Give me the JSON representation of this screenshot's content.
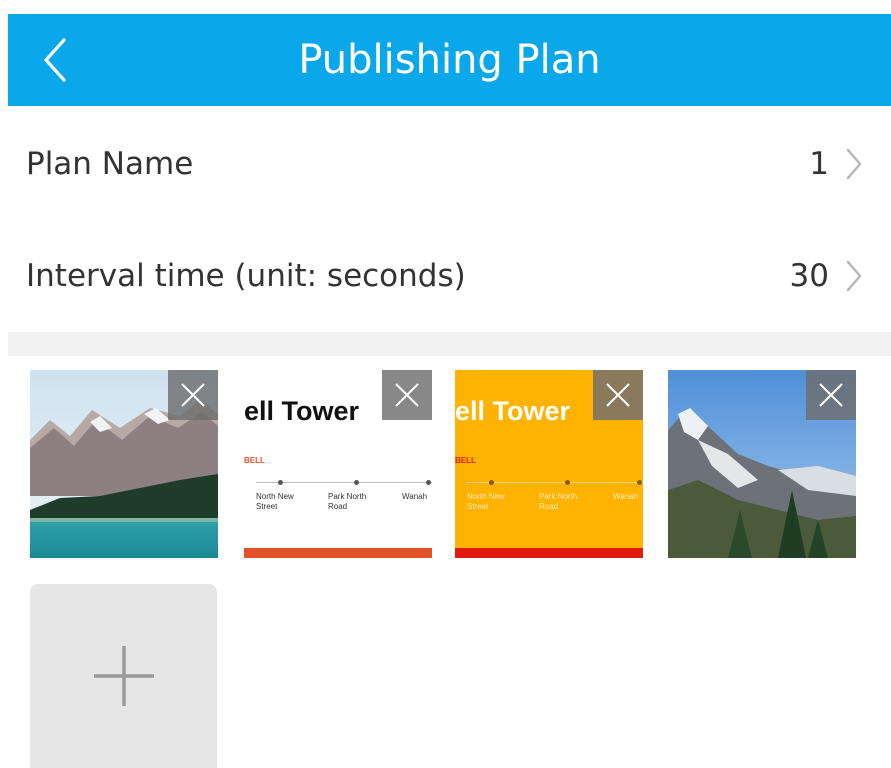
{
  "header": {
    "title": "Publishing Plan",
    "back_icon": "chevron-left-icon",
    "background_color": "#0aa7ea"
  },
  "settings": {
    "plan_name": {
      "label": "Plan Name",
      "value": "1",
      "chevron_icon": "chevron-right-icon"
    },
    "interval": {
      "label": "Interval time (unit: seconds)",
      "value": "30",
      "chevron_icon": "chevron-right-icon"
    }
  },
  "media": {
    "items": [
      {
        "kind": "image",
        "description_icon": "mountain-lake-photo"
      },
      {
        "kind": "slide",
        "title": "ell Tower",
        "tag": "BELL",
        "stops": [
          "North New Street",
          "Park North Road",
          "Wanah"
        ],
        "background": "#ffffff",
        "title_color": "#111111",
        "bar_color": "#e0522a"
      },
      {
        "kind": "slide",
        "title": "ell Tower",
        "tag": "BELL",
        "stops": [
          "North New Street",
          "Park North Road",
          "Wanah"
        ],
        "background": "#ffb300",
        "title_color": "#ffffff",
        "bar_color": "#e21c0c"
      },
      {
        "kind": "image",
        "description_icon": "mountain-trees-photo"
      }
    ],
    "delete_icon": "close-icon",
    "add_icon": "plus-icon"
  }
}
